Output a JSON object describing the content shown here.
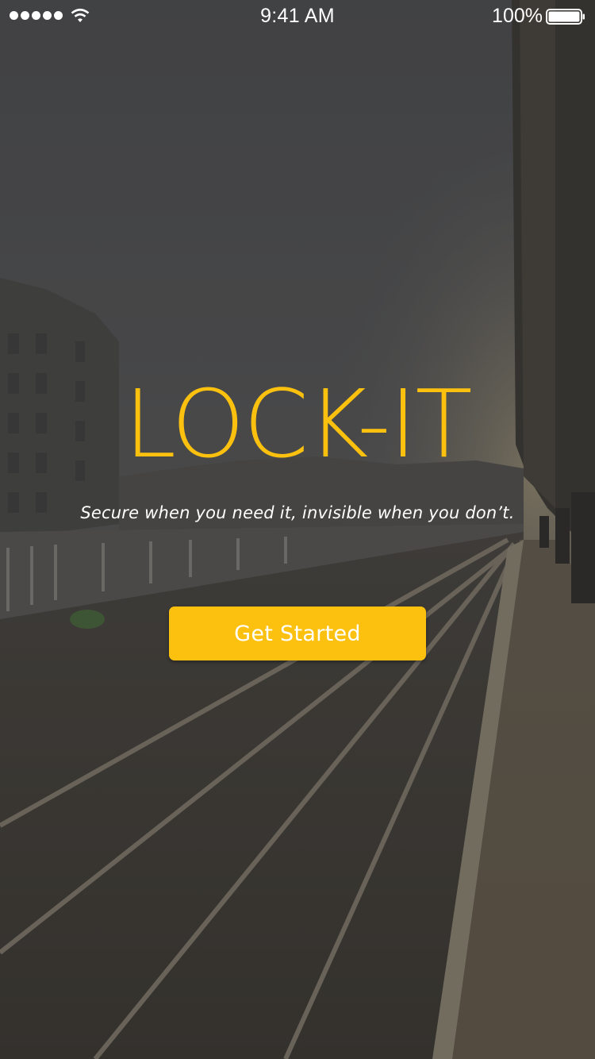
{
  "status_bar": {
    "time": "9:41 AM",
    "battery_percent": "100%",
    "signal_icon": "signal-dots-icon",
    "wifi_icon": "wifi-icon",
    "battery_icon": "battery-icon"
  },
  "hero": {
    "title": "LOCK-IT",
    "tagline": "Secure when you need it, invisible when you don’t."
  },
  "actions": {
    "get_started_label": "Get Started"
  },
  "colors": {
    "accent": "#fcc10f",
    "text_light": "#ffffff",
    "background_dark": "#2e2e30"
  }
}
